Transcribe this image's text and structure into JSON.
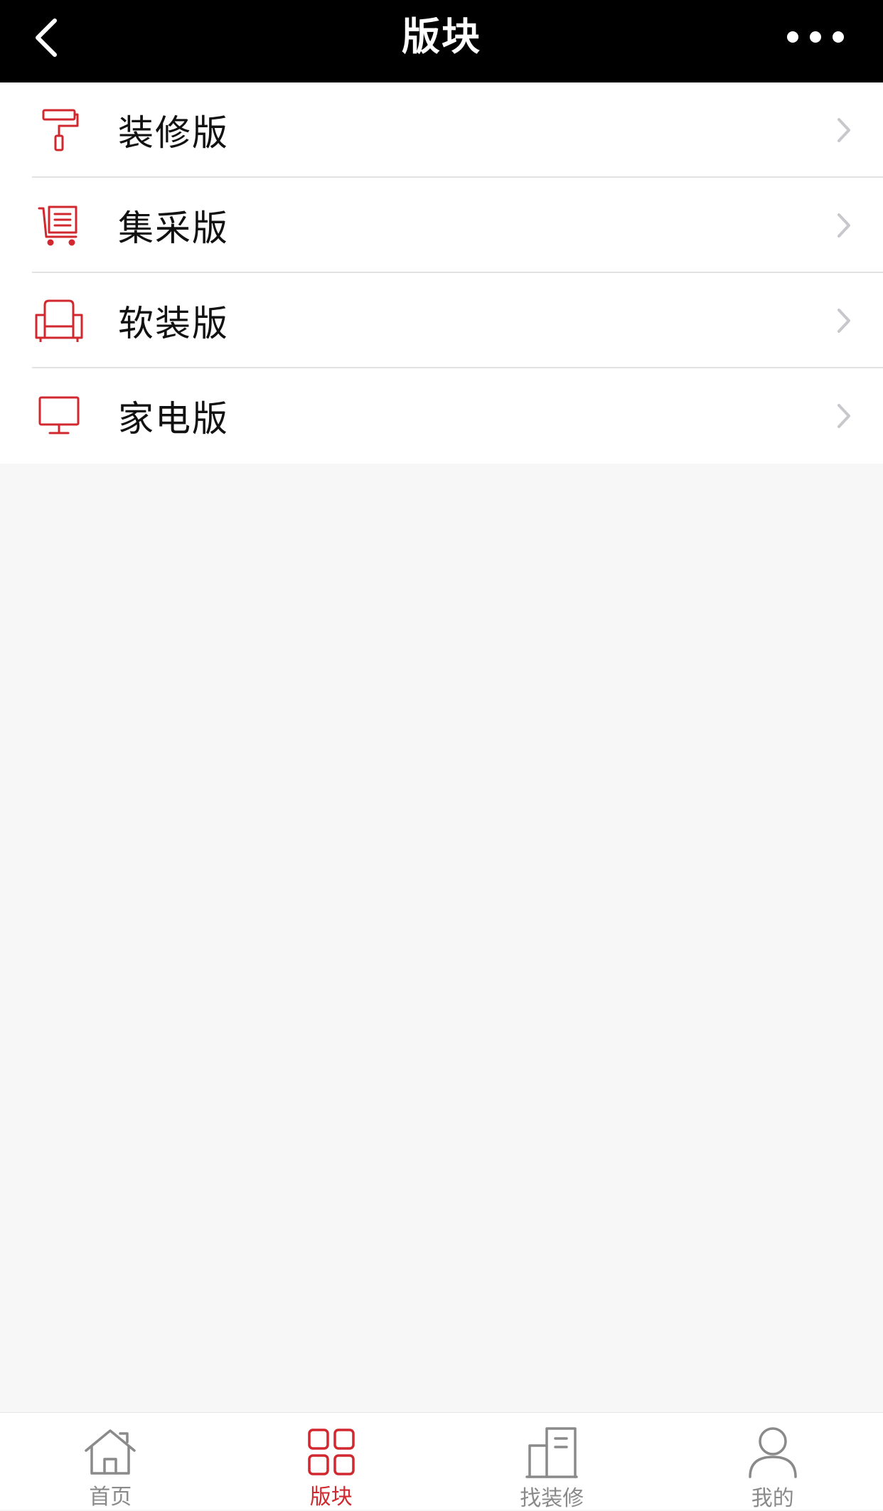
{
  "header": {
    "title": "版块",
    "back_icon": "chevron-left-icon",
    "more_icon": "more-dots-icon"
  },
  "sections": [
    {
      "label": "装修版",
      "icon": "paint-roller-icon"
    },
    {
      "label": "集采版",
      "icon": "cart-icon"
    },
    {
      "label": "软装版",
      "icon": "armchair-icon"
    },
    {
      "label": "家电版",
      "icon": "monitor-icon"
    }
  ],
  "tabbar": {
    "active_index": 1,
    "tabs": [
      {
        "label": "首页",
        "icon": "home-icon"
      },
      {
        "label": "版块",
        "icon": "grid-icon"
      },
      {
        "label": "找装修",
        "icon": "building-icon"
      },
      {
        "label": "我的",
        "icon": "user-icon"
      }
    ]
  },
  "colors": {
    "header_bg": "#000000",
    "accent": "#d0282e",
    "inactive": "#8a8a8a",
    "page_bg": "#f7f7f7",
    "chevron": "#c7c7cc"
  }
}
